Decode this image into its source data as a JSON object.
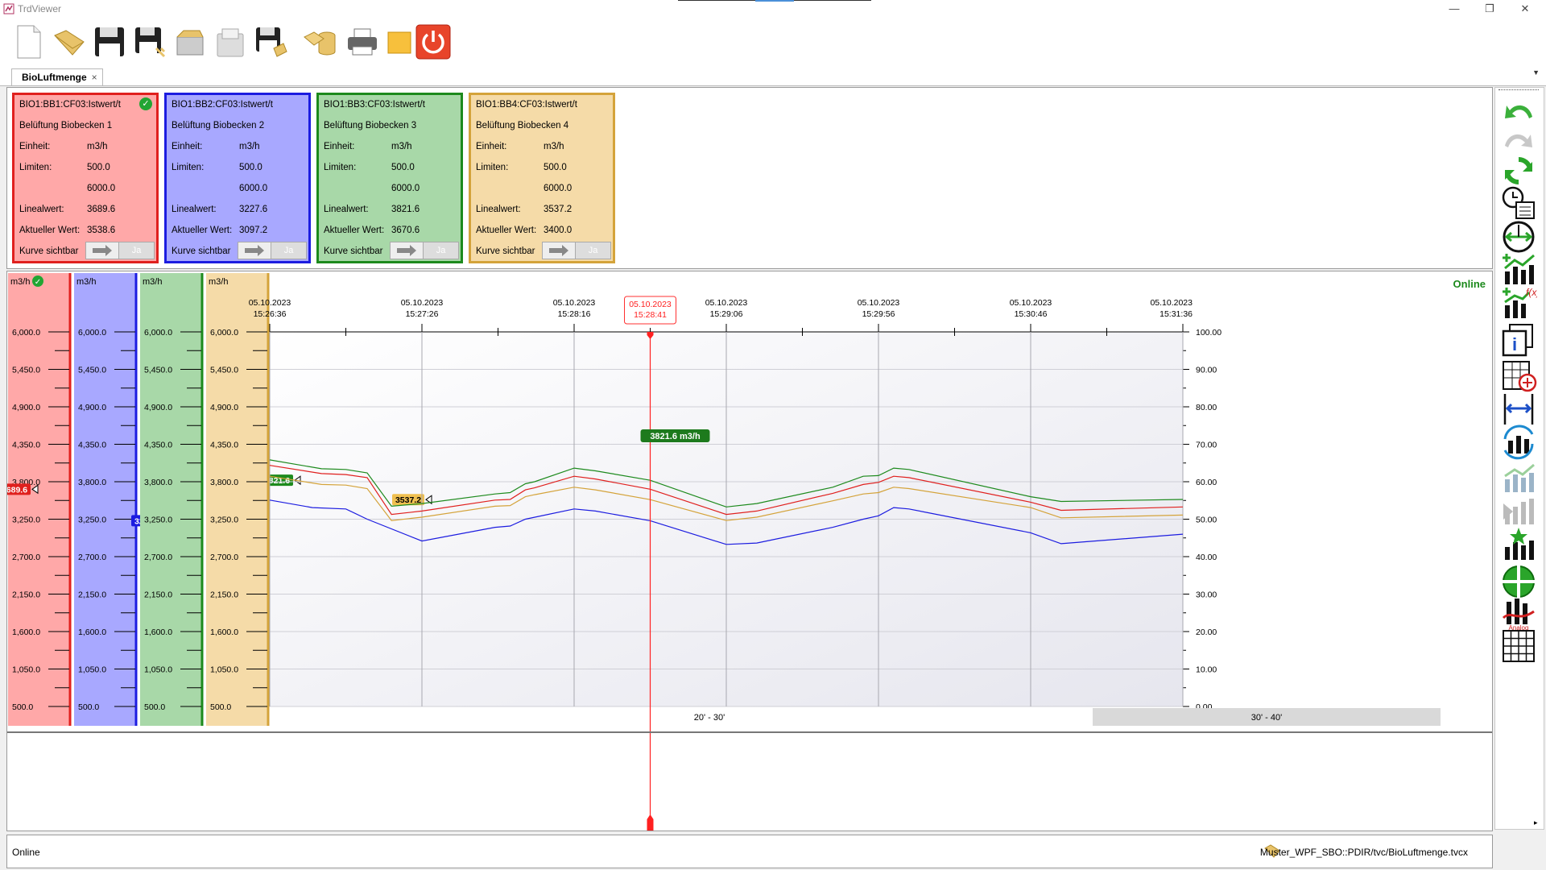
{
  "window": {
    "title": "TrdViewer",
    "minimize": "—",
    "restore": "❐",
    "close": "✕"
  },
  "toolbar": {
    "icons": [
      "new-document-icon",
      "open-folder-icon",
      "save-icon",
      "save-as-icon",
      "open-folder-2-icon",
      "document-icon",
      "save-multiple-icon",
      "database-icon",
      "printer-icon",
      "note-icon",
      "power-icon"
    ]
  },
  "tab": {
    "label": "BioLuftmenge",
    "close": "×"
  },
  "labels": {
    "einheit": "Einheit:",
    "limiten": "Limiten:",
    "linealwert": "Linealwert:",
    "aktueller_wert": "Aktueller Wert:",
    "kurve_sichtbar": "Kurve sichtbar",
    "ja": "Ja"
  },
  "cards": [
    {
      "tag": "BIO1:BB1:CF03:Istwert/t",
      "name": "Belüftung Biobecken 1",
      "einheit": "m3/h",
      "limit_low": "500.0",
      "limit_high": "6000.0",
      "linealwert": "3689.6",
      "aktuell": "3538.6",
      "fill": "#ffa8a8",
      "border": "#e0201e",
      "checked": true
    },
    {
      "tag": "BIO1:BB2:CF03:Istwert/t",
      "name": "Belüftung Biobecken 2",
      "einheit": "m3/h",
      "limit_low": "500.0",
      "limit_high": "6000.0",
      "linealwert": "3227.6",
      "aktuell": "3097.2",
      "fill": "#a8a8ff",
      "border": "#1c1ce0",
      "checked": false
    },
    {
      "tag": "BIO1:BB3:CF03:Istwert/t",
      "name": "Belüftung Biobecken 3",
      "einheit": "m3/h",
      "limit_low": "500.0",
      "limit_high": "6000.0",
      "linealwert": "3821.6",
      "aktuell": "3670.6",
      "fill": "#a8d8a8",
      "border": "#1d8a1d",
      "checked": false
    },
    {
      "tag": "BIO1:BB4:CF03:Istwert/t",
      "name": "Belüftung Biobecken 4",
      "einheit": "m3/h",
      "limit_low": "500.0",
      "limit_high": "6000.0",
      "linealwert": "3537.2",
      "aktuell": "3400.0",
      "fill": "#f5dba8",
      "border": "#d4a33a",
      "checked": false
    }
  ],
  "chart": {
    "online_label": "Online",
    "cursor_date": "05.10.2023",
    "cursor_time": "15:28:41",
    "cursor_value_label": "3821.6 m3/h",
    "range_labels": [
      "20' - 30'",
      "30' - 40'"
    ]
  },
  "chart_data": {
    "type": "line",
    "x_date": "05.10.2023",
    "x_ticks": [
      "15:26:36",
      "15:27:26",
      "15:28:16",
      "15:29:06",
      "15:29:56",
      "15:30:46",
      "15:31:36"
    ],
    "x_range": [
      "15:26:36",
      "15:31:36"
    ],
    "y_axis_unit": "m3/h",
    "left_ticks": [
      "6,000.0",
      "5,450.0",
      "4,900.0",
      "4,350.0",
      "3,800.0",
      "3,250.0",
      "2,700.0",
      "2,150.0",
      "1,600.0",
      "1,050.0",
      "500.0"
    ],
    "ylim": [
      500,
      6000
    ],
    "right_ticks": [
      "100.00",
      "90.00",
      "80.00",
      "70.00",
      "60.00",
      "50.00",
      "40.00",
      "30.00",
      "20.00",
      "10.00",
      "0.00"
    ],
    "right_ylim": [
      0,
      100
    ],
    "grid": true,
    "axis_markers": [
      "3689.6",
      "3227.6",
      "3821.6",
      "3537.2"
    ],
    "series": [
      {
        "color": "#e0201e",
        "points": [
          [
            "15:26:36",
            4040
          ],
          [
            "15:26:53",
            3920
          ],
          [
            "15:27:01",
            3905
          ],
          [
            "15:27:08",
            3860
          ],
          [
            "15:27:16",
            3320
          ],
          [
            "15:27:26",
            3370
          ],
          [
            "15:27:50",
            3530
          ],
          [
            "15:27:55",
            3540
          ],
          [
            "15:28:00",
            3680
          ],
          [
            "15:28:03",
            3710
          ],
          [
            "15:28:16",
            3880
          ],
          [
            "15:28:23",
            3840
          ],
          [
            "15:28:41",
            3689.6
          ],
          [
            "15:29:06",
            3320
          ],
          [
            "15:29:16",
            3370
          ],
          [
            "15:29:41",
            3630
          ],
          [
            "15:29:51",
            3760
          ],
          [
            "15:29:56",
            3790
          ],
          [
            "15:30:01",
            3880
          ],
          [
            "15:30:06",
            3860
          ],
          [
            "15:30:46",
            3500
          ],
          [
            "15:30:56",
            3380
          ],
          [
            "15:31:36",
            3430
          ]
        ]
      },
      {
        "color": "#1c1ce0",
        "points": [
          [
            "15:26:36",
            3530
          ],
          [
            "15:26:50",
            3420
          ],
          [
            "15:27:01",
            3400
          ],
          [
            "15:27:08",
            3250
          ],
          [
            "15:27:26",
            2930
          ],
          [
            "15:27:50",
            3130
          ],
          [
            "15:27:55",
            3150
          ],
          [
            "15:28:00",
            3250
          ],
          [
            "15:28:16",
            3400
          ],
          [
            "15:28:23",
            3370
          ],
          [
            "15:28:41",
            3227.6
          ],
          [
            "15:29:06",
            2880
          ],
          [
            "15:29:16",
            2900
          ],
          [
            "15:29:41",
            3130
          ],
          [
            "15:29:51",
            3250
          ],
          [
            "15:29:56",
            3300
          ],
          [
            "15:30:01",
            3420
          ],
          [
            "15:30:06",
            3400
          ],
          [
            "15:30:46",
            3050
          ],
          [
            "15:30:56",
            2890
          ],
          [
            "15:31:36",
            3030
          ]
        ]
      },
      {
        "color": "#1d8a1d",
        "points": [
          [
            "15:26:36",
            4120
          ],
          [
            "15:26:53",
            3990
          ],
          [
            "15:27:01",
            3980
          ],
          [
            "15:27:08",
            3930
          ],
          [
            "15:27:16",
            3440
          ],
          [
            "15:27:26",
            3480
          ],
          [
            "15:27:50",
            3620
          ],
          [
            "15:27:55",
            3640
          ],
          [
            "15:28:00",
            3770
          ],
          [
            "15:28:03",
            3800
          ],
          [
            "15:28:16",
            4000
          ],
          [
            "15:28:23",
            3960
          ],
          [
            "15:28:41",
            3821.6
          ],
          [
            "15:29:06",
            3430
          ],
          [
            "15:29:16",
            3480
          ],
          [
            "15:29:41",
            3720
          ],
          [
            "15:29:51",
            3880
          ],
          [
            "15:29:56",
            3890
          ],
          [
            "15:30:01",
            4000
          ],
          [
            "15:30:06",
            3980
          ],
          [
            "15:30:46",
            3580
          ],
          [
            "15:30:56",
            3510
          ],
          [
            "15:31:36",
            3540
          ]
        ]
      },
      {
        "color": "#d4a33a",
        "points": [
          [
            "15:26:36",
            3880
          ],
          [
            "15:26:53",
            3760
          ],
          [
            "15:27:01",
            3750
          ],
          [
            "15:27:08",
            3700
          ],
          [
            "15:27:16",
            3230
          ],
          [
            "15:27:26",
            3280
          ],
          [
            "15:27:50",
            3440
          ],
          [
            "15:27:55",
            3450
          ],
          [
            "15:28:00",
            3580
          ],
          [
            "15:28:03",
            3610
          ],
          [
            "15:28:16",
            3720
          ],
          [
            "15:28:23",
            3680
          ],
          [
            "15:28:41",
            3537.2
          ],
          [
            "15:29:06",
            3230
          ],
          [
            "15:29:16",
            3280
          ],
          [
            "15:29:41",
            3520
          ],
          [
            "15:29:51",
            3620
          ],
          [
            "15:29:56",
            3640
          ],
          [
            "15:30:01",
            3720
          ],
          [
            "15:30:06",
            3700
          ],
          [
            "15:30:46",
            3420
          ],
          [
            "15:30:56",
            3270
          ],
          [
            "15:31:36",
            3310
          ]
        ]
      }
    ]
  },
  "status": {
    "state": "Online",
    "file": "Muster_WPF_SBO::PDIR/tvc/BioLuftmenge.tvcx"
  },
  "rightbar": {
    "icons": [
      "undo-icon",
      "redo-icon",
      "refresh-icon",
      "calendar-clock-icon",
      "time-range-icon",
      "add-chart-icon",
      "add-function-chart-icon",
      "info-icon",
      "table-settings-icon",
      "ruler-icon",
      "sync-chart-icon",
      "chart-disabled-icon",
      "chart-disabled-2-icon",
      "star-chart-icon",
      "crosshair-icon",
      "analog-icon",
      "grid-icon"
    ]
  }
}
